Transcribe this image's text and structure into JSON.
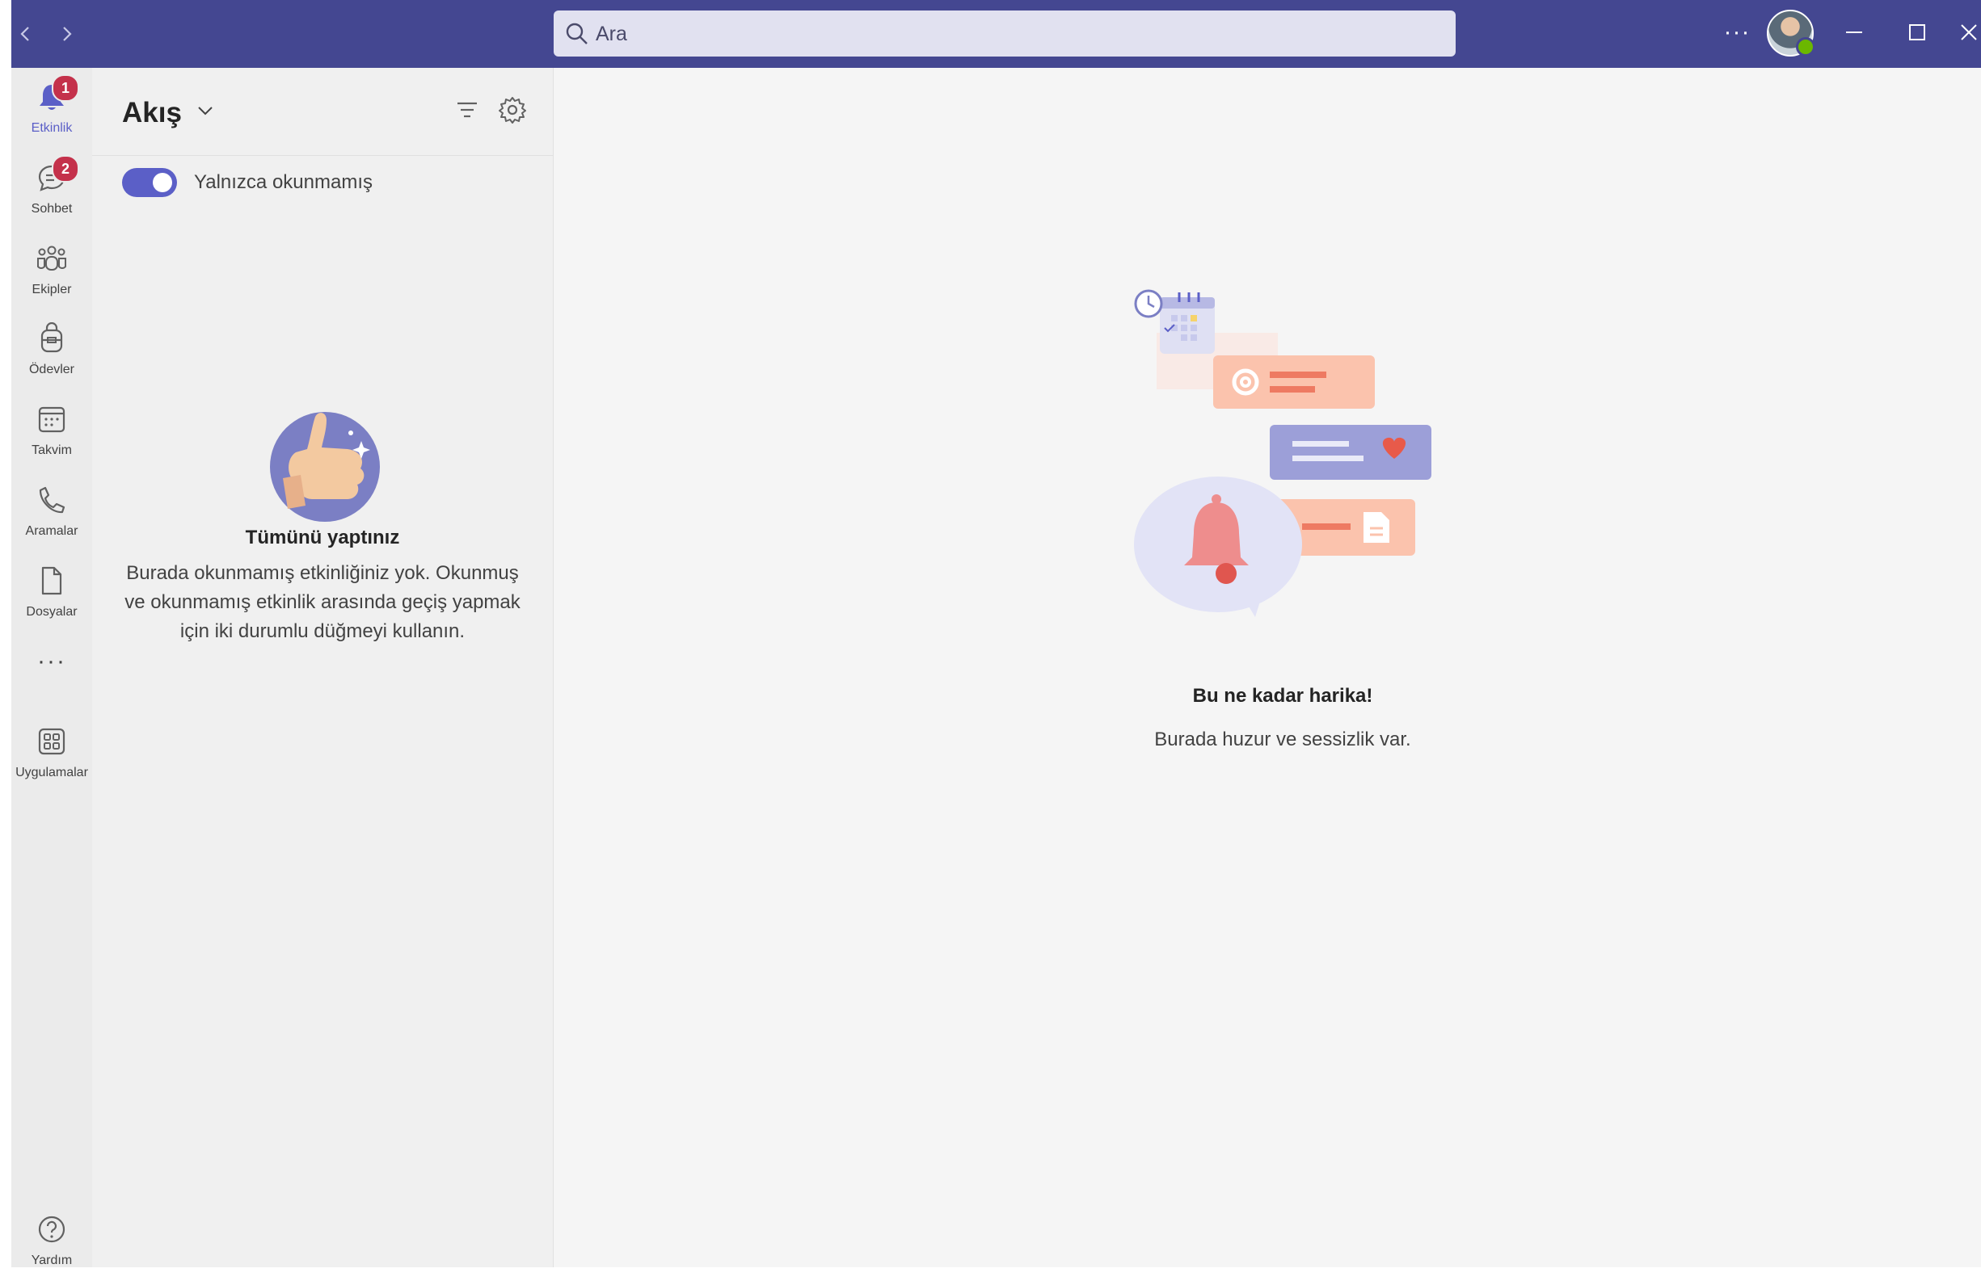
{
  "titlebar": {
    "search_placeholder": "Ara",
    "more_label": "···"
  },
  "rail": {
    "items": [
      {
        "label": "Etkinlik",
        "badge": "1",
        "icon": "bell-icon"
      },
      {
        "label": "Sohbet",
        "badge": "2",
        "icon": "chat-icon"
      },
      {
        "label": "Ekipler",
        "icon": "teams-icon"
      },
      {
        "label": "Ödevler",
        "icon": "assignments-icon"
      },
      {
        "label": "Takvim",
        "icon": "calendar-icon"
      },
      {
        "label": "Aramalar",
        "icon": "phone-icon"
      },
      {
        "label": "Dosyalar",
        "icon": "file-icon"
      }
    ],
    "more_label": "···",
    "apps_label": "Uygulamalar",
    "help_label": "Yardım"
  },
  "pane": {
    "title": "Akış",
    "toggle_label": "Yalnızca okunmamış",
    "toggle_on": true,
    "empty_title": "Tümünü yaptınız",
    "empty_desc": "Burada okunmamış etkinliğiniz yok. Okunmuş ve okunmamış etkinlik arasında geçiş yapmak için iki durumlu düğmeyi kullanın."
  },
  "main": {
    "title": "Bu ne kadar harika!",
    "subtitle": "Burada huzur ve sessizlik var."
  },
  "colors": {
    "titlebar": "#444791",
    "accent": "#5b5fc7",
    "badge": "#c4314b"
  }
}
